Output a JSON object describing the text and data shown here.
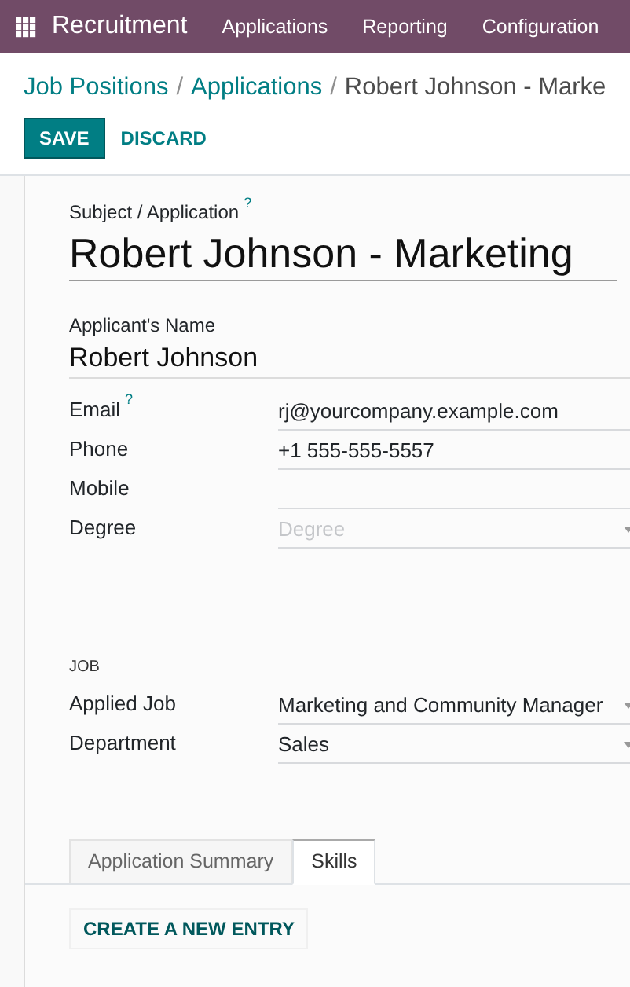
{
  "navbar": {
    "app_name": "Recruitment",
    "menu": [
      "Applications",
      "Reporting",
      "Configuration"
    ]
  },
  "breadcrumbs": [
    {
      "label": "Job Positions",
      "separator": "/"
    },
    {
      "label": "Applications",
      "separator": "/"
    },
    {
      "label": "Robert Johnson - Marke"
    }
  ],
  "actions": {
    "save": "SAVE",
    "discard": "DISCARD"
  },
  "subject": {
    "label": "Subject / Application",
    "help": "?",
    "value": "Robert Johnson - Marketing"
  },
  "applicant": {
    "label": "Applicant's Name",
    "value": "Robert Johnson"
  },
  "contact_fields": [
    {
      "label": "Email",
      "help": "?",
      "kind": "text",
      "value": "rj@yourcompany.example.com"
    },
    {
      "label": "Phone",
      "kind": "text",
      "value": "+1 555-555-5557"
    },
    {
      "label": "Mobile",
      "kind": "text"
    },
    {
      "label": "Degree",
      "kind": "select",
      "placeholder": "Degree"
    }
  ],
  "job_section": {
    "title": "JOB",
    "fields": [
      {
        "label": "Applied Job",
        "kind": "select",
        "value": "Marketing and Community Manager"
      },
      {
        "label": "Department",
        "kind": "select",
        "value": "Sales"
      }
    ]
  },
  "tabs": [
    {
      "label": "Application Summary",
      "selected": false
    },
    {
      "label": "Skills",
      "selected": true
    }
  ],
  "create_entry": "CREATE A NEW ENTRY"
}
